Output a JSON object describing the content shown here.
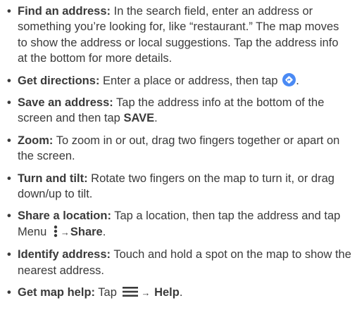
{
  "items": [
    {
      "term": "Find an address:",
      "text": " In the search field, enter an address or something you’re looking for, like “restaurant.” The map moves to show the address or local suggestions. Tap the address info at the bottom for more details."
    },
    {
      "term": "Get directions:",
      "text": " Enter a place or address, then tap ",
      "text_after": ".",
      "icon": "directions-icon"
    },
    {
      "term": "Save an address:",
      "text": " Tap the address info at the bottom of the screen and then tap ",
      "bold": "SAVE",
      "text_after": "."
    },
    {
      "term": "Zoom:",
      "text": " To zoom in or out, drag two fingers together or apart on the screen."
    },
    {
      "term": "Turn and tilt:",
      "text": " Rotate two fingers on the map to turn it, or drag down/up to tilt."
    },
    {
      "term": "Share a location:",
      "text": " Tap a location, then tap the address and tap Menu ",
      "icon": "menu-dots-icon",
      "arrow": "→",
      "bold": "Share",
      "text_after": "."
    },
    {
      "term": "Identify address:",
      "text": " Touch and hold a spot on the map to show the nearest address."
    },
    {
      "term": "Get map help:",
      "text": " Tap ",
      "icon": "hamburger-menu-icon",
      "arrow": "→",
      "bold": "Help",
      "text_after": "."
    }
  ],
  "colors": {
    "text": "#3a3a3a",
    "directions_icon": "#4a8af4"
  }
}
